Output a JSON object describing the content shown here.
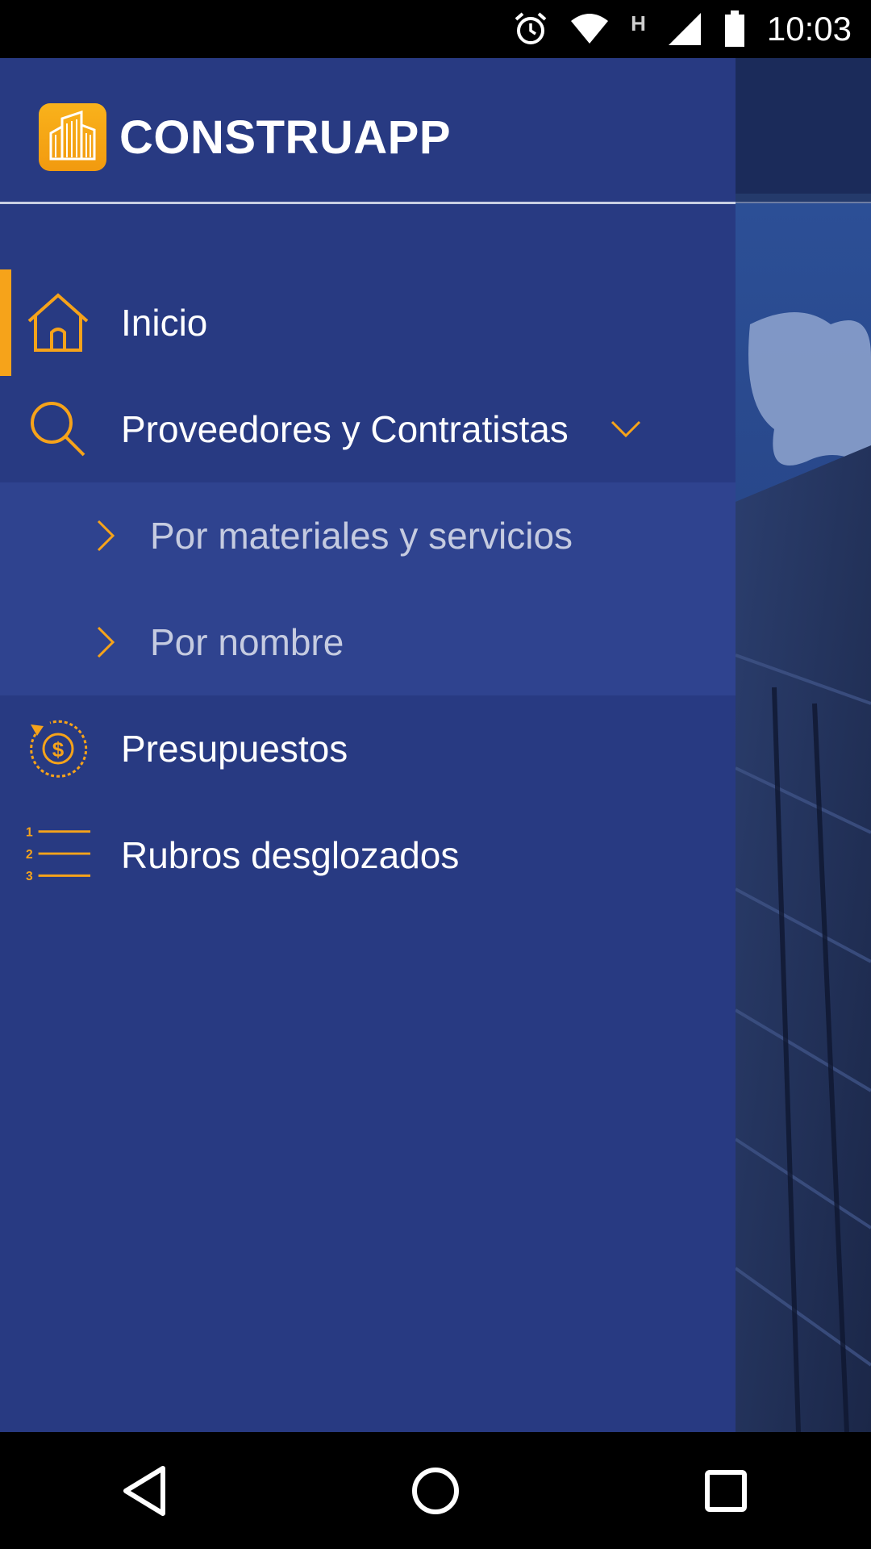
{
  "status_bar": {
    "time": "10:03",
    "network_letter": "H",
    "icons": [
      "alarm-icon",
      "wifi-icon",
      "signal-icon",
      "battery-icon"
    ]
  },
  "drawer": {
    "app_name": "CONSTRUAPP",
    "accent_color": "#f6a31a",
    "background_color": "#283a82",
    "items": [
      {
        "label": "Inicio",
        "icon": "home-icon",
        "active": true
      },
      {
        "label": "Proveedores y Contratistas",
        "icon": "search-icon",
        "expanded": true,
        "subitems": [
          {
            "label": "Por materiales y servicios"
          },
          {
            "label": "Por nombre"
          }
        ]
      },
      {
        "label": "Presupuestos",
        "icon": "budget-dollar-icon"
      },
      {
        "label": "Rubros desglozados",
        "icon": "numbered-list-icon"
      }
    ]
  },
  "nav_bar": {
    "buttons": [
      "back-icon",
      "home-circle-icon",
      "recents-icon"
    ]
  }
}
